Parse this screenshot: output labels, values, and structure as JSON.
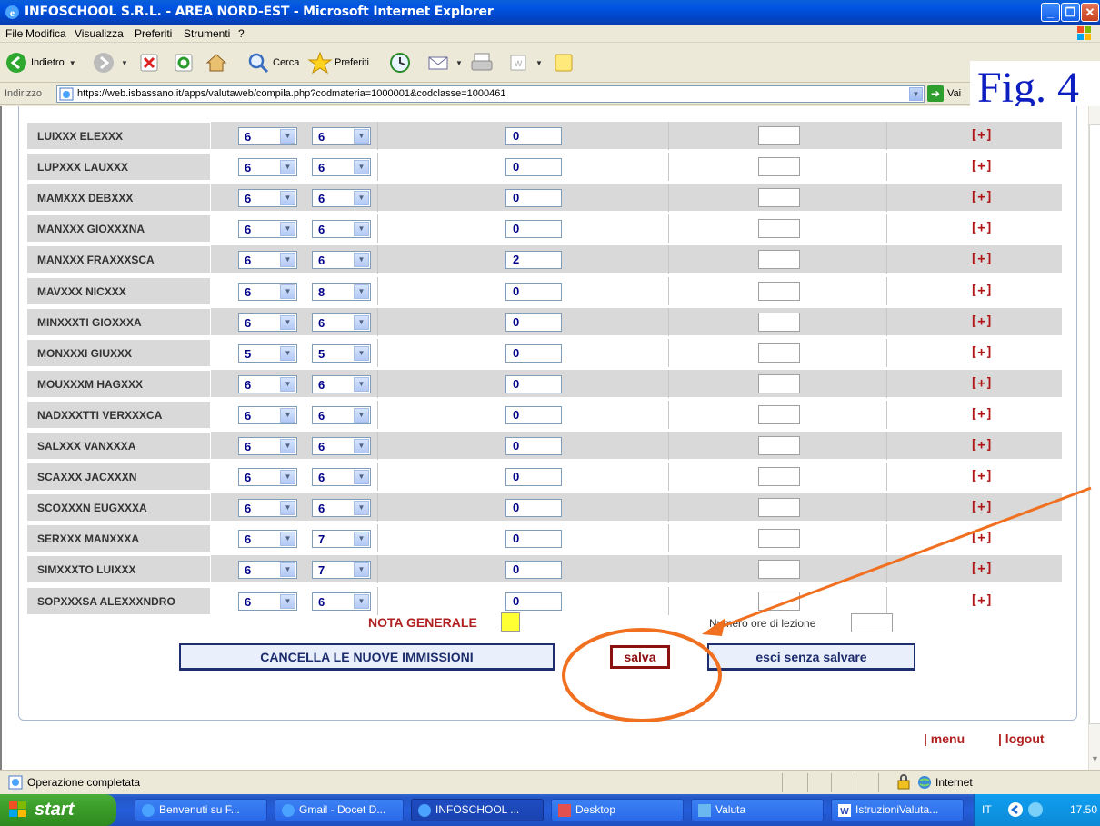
{
  "window": {
    "title": "INFOSCHOOL S.R.L. - AREA NORD-EST - Microsoft Internet Explorer"
  },
  "menu": [
    "File",
    "Modifica",
    "Visualizza",
    "Preferiti",
    "Strumenti",
    "?"
  ],
  "toolbar": {
    "back": "Indietro",
    "search": "Cerca",
    "favorites": "Preferiti"
  },
  "address": {
    "label": "Indirizzo",
    "url": "https://web.isbassano.it/apps/valutaweb/compila.php?codmateria=1000001&codclasse=1000461",
    "go": "Vai"
  },
  "figure_label": "Fig. 4",
  "students": [
    {
      "name": "LUIXXX ELEXXX",
      "v1": "6",
      "v2": "6",
      "n": "0",
      "add": "[+]"
    },
    {
      "name": "LUPXXX LAUXXX",
      "v1": "6",
      "v2": "6",
      "n": "0",
      "add": "[+]"
    },
    {
      "name": "MAMXXX DEBXXX",
      "v1": "6",
      "v2": "6",
      "n": "0",
      "add": "[+]"
    },
    {
      "name": "MANXXX GIOXXXNA",
      "v1": "6",
      "v2": "6",
      "n": "0",
      "add": "[+]"
    },
    {
      "name": "MANXXX FRAXXXSCA",
      "v1": "6",
      "v2": "6",
      "n": "2",
      "add": "[+]"
    },
    {
      "name": "MAVXXX NICXXX",
      "v1": "6",
      "v2": "8",
      "n": "0",
      "add": "[+]"
    },
    {
      "name": "MINXXXTI GIOXXXA",
      "v1": "6",
      "v2": "6",
      "n": "0",
      "add": "[+]"
    },
    {
      "name": "MONXXXI GIUXXX",
      "v1": "5",
      "v2": "5",
      "n": "0",
      "add": "[+]"
    },
    {
      "name": "MOUXXXM HAGXXX",
      "v1": "6",
      "v2": "6",
      "n": "0",
      "add": "[+]"
    },
    {
      "name": "NADXXXTTI VERXXXCA",
      "v1": "6",
      "v2": "6",
      "n": "0",
      "add": "[+]"
    },
    {
      "name": "SALXXX VANXXXA",
      "v1": "6",
      "v2": "6",
      "n": "0",
      "add": "[+]"
    },
    {
      "name": "SCAXXX JACXXXN",
      "v1": "6",
      "v2": "6",
      "n": "0",
      "add": "[+]"
    },
    {
      "name": "SCOXXXN EUGXXXA",
      "v1": "6",
      "v2": "6",
      "n": "0",
      "add": "[+]"
    },
    {
      "name": "SERXXX MANXXXA",
      "v1": "6",
      "v2": "7",
      "n": "0",
      "add": "[+]"
    },
    {
      "name": "SIMXXXTO LUIXXX",
      "v1": "6",
      "v2": "7",
      "n": "0",
      "add": "[+]"
    },
    {
      "name": "SOPXXXSA ALEXXXNDRO",
      "v1": "6",
      "v2": "6",
      "n": "0",
      "add": "[+]"
    }
  ],
  "form": {
    "nota_generale": "NOTA GENERALE",
    "numero_ore": "Numero ore di lezione",
    "cancel_button": "CANCELLA LE NUOVE IMMISSIONI",
    "save_button": "salva",
    "exit_button": "esci senza salvare",
    "menu_link": "| menu",
    "logout_link": "| logout"
  },
  "status": {
    "text": "Operazione completata",
    "zone": "Internet"
  },
  "taskbar": {
    "start": "start",
    "tasks": [
      "Benvenuti su F...",
      "Gmail - Docet D...",
      "INFOSCHOOL ...",
      "Desktop",
      "Valuta",
      "IstruzioniValuta..."
    ],
    "lang": "IT",
    "clock": "17.50"
  },
  "colors": {
    "annotation": "#f07020",
    "name_cell": "#d9d9d9",
    "link_red": "#b02020"
  }
}
